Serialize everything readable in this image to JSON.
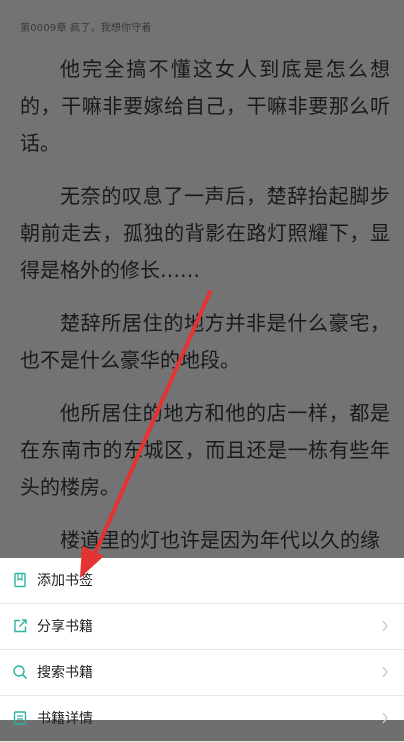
{
  "reader": {
    "chapter_header": "第0009章 疯了，我想你守着",
    "paragraphs": [
      "他完全搞不懂这女人到底是怎么想的，干嘛非要嫁给自己，干嘛非要那么听话。",
      "无奈的叹息了一声后，楚辞抬起脚步朝前走去，孤独的背影在路灯照耀下，显得是格外的修长……",
      "楚辞所居住的地方并非是什么豪宅，也不是什么豪华的地段。",
      "他所居住的地方和他的店一样，都是在东南市的东城区，而且还是一栋有些年头的楼房。",
      "楼道里的灯也许是因为年代以久的缘"
    ]
  },
  "menu": {
    "items": [
      {
        "label": "添加书签",
        "icon": "bookmark-icon"
      },
      {
        "label": "分享书籍",
        "icon": "share-icon"
      },
      {
        "label": "搜索书籍",
        "icon": "search-icon"
      },
      {
        "label": "书籍详情",
        "icon": "info-icon"
      }
    ]
  },
  "colors": {
    "accent": "#2bb6a3",
    "annotation_arrow": "#e53232"
  }
}
